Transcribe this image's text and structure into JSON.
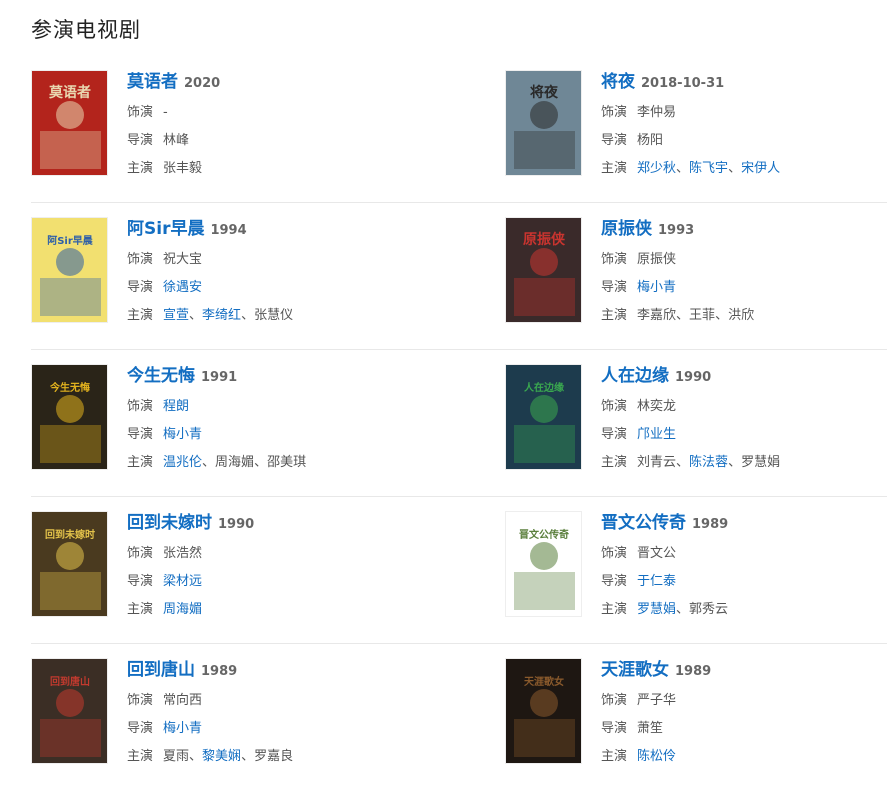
{
  "section": {
    "title": "参演电视剧"
  },
  "labels": {
    "role": "饰演",
    "director": "导演",
    "cast": "主演"
  },
  "shows": [
    {
      "title": "莫语者",
      "year": "2020",
      "role": [
        {
          "text": "-",
          "link": false
        }
      ],
      "director": [
        {
          "text": "林峰",
          "link": false
        }
      ],
      "cast": [
        {
          "text": "张丰毅",
          "link": false
        }
      ],
      "poster": {
        "bg": "#b3241c",
        "accent": "#e9d7b0",
        "text": "莫语者"
      }
    },
    {
      "title": "将夜",
      "year": "2018-10-31",
      "role": [
        {
          "text": "李仲易",
          "link": false
        }
      ],
      "director": [
        {
          "text": "杨阳",
          "link": false
        }
      ],
      "cast": [
        {
          "text": "郑少秋",
          "link": true
        },
        {
          "text": "陈飞宇",
          "link": true
        },
        {
          "text": "宋伊人",
          "link": true
        }
      ],
      "poster": {
        "bg": "#6f8796",
        "accent": "#2a2a2a",
        "text": "将夜"
      }
    },
    {
      "title": "阿Sir早晨",
      "year": "1994",
      "role": [
        {
          "text": "祝大宝",
          "link": false
        }
      ],
      "director": [
        {
          "text": "徐遇安",
          "link": true
        }
      ],
      "cast": [
        {
          "text": "宣萱",
          "link": true
        },
        {
          "text": "李绮红",
          "link": true
        },
        {
          "text": "张慧仪",
          "link": false
        }
      ],
      "poster": {
        "bg": "#f2e070",
        "accent": "#2d5fa8",
        "text": "阿Sir早晨"
      }
    },
    {
      "title": "原振侠",
      "year": "1993",
      "role": [
        {
          "text": "原振侠",
          "link": false
        }
      ],
      "director": [
        {
          "text": "梅小青",
          "link": true
        }
      ],
      "cast": [
        {
          "text": "李嘉欣",
          "link": false
        },
        {
          "text": "王菲",
          "link": false
        },
        {
          "text": "洪欣",
          "link": false
        }
      ],
      "poster": {
        "bg": "#3a2a2a",
        "accent": "#c9342f",
        "text": "原振侠"
      }
    },
    {
      "title": "今生无悔",
      "year": "1991",
      "role": [
        {
          "text": "程朗",
          "link": true
        }
      ],
      "director": [
        {
          "text": "梅小青",
          "link": true
        }
      ],
      "cast": [
        {
          "text": "温兆伦",
          "link": true
        },
        {
          "text": "周海媚",
          "link": false
        },
        {
          "text": "邵美琪",
          "link": false
        }
      ],
      "poster": {
        "bg": "#2a2418",
        "accent": "#e2b21e",
        "text": "今生无悔"
      }
    },
    {
      "title": "人在边缘",
      "year": "1990",
      "role": [
        {
          "text": "林奕龙",
          "link": false
        }
      ],
      "director": [
        {
          "text": "邝业生",
          "link": true
        }
      ],
      "cast": [
        {
          "text": "刘青云",
          "link": false
        },
        {
          "text": "陈法蓉",
          "link": true
        },
        {
          "text": "罗慧娟",
          "link": false
        }
      ],
      "poster": {
        "bg": "#1d3b4d",
        "accent": "#3aa84f",
        "text": "人在边缘"
      }
    },
    {
      "title": "回到未嫁时",
      "year": "1990",
      "role": [
        {
          "text": "张浩然",
          "link": false
        }
      ],
      "director": [
        {
          "text": "梁材远",
          "link": true
        }
      ],
      "cast": [
        {
          "text": "周海媚",
          "link": true
        }
      ],
      "poster": {
        "bg": "#4a3a1f",
        "accent": "#e3c24a",
        "text": "回到未嫁时"
      }
    },
    {
      "title": "晋文公传奇",
      "year": "1989",
      "role": [
        {
          "text": "晋文公",
          "link": false
        }
      ],
      "director": [
        {
          "text": "于仁泰",
          "link": true
        }
      ],
      "cast": [
        {
          "text": "罗慧娟",
          "link": true
        },
        {
          "text": "郭秀云",
          "link": false
        }
      ],
      "poster": {
        "bg": "#ffffff",
        "accent": "#5a7f3c",
        "text": "晋文公传奇"
      }
    },
    {
      "title": "回到唐山",
      "year": "1989",
      "role": [
        {
          "text": "常向西",
          "link": false
        }
      ],
      "director": [
        {
          "text": "梅小青",
          "link": true
        }
      ],
      "cast": [
        {
          "text": "夏雨",
          "link": false
        },
        {
          "text": "黎美娴",
          "link": true
        },
        {
          "text": "罗嘉良",
          "link": false
        }
      ],
      "poster": {
        "bg": "#3b2e25",
        "accent": "#c23a2e",
        "text": "回到唐山"
      }
    },
    {
      "title": "天涯歌女",
      "year": "1989",
      "role": [
        {
          "text": "严子华",
          "link": false
        }
      ],
      "director": [
        {
          "text": "萧笙",
          "link": false
        }
      ],
      "cast": [
        {
          "text": "陈松伶",
          "link": true
        }
      ],
      "poster": {
        "bg": "#1e1712",
        "accent": "#8a5a2c",
        "text": "天涯歌女"
      }
    }
  ]
}
